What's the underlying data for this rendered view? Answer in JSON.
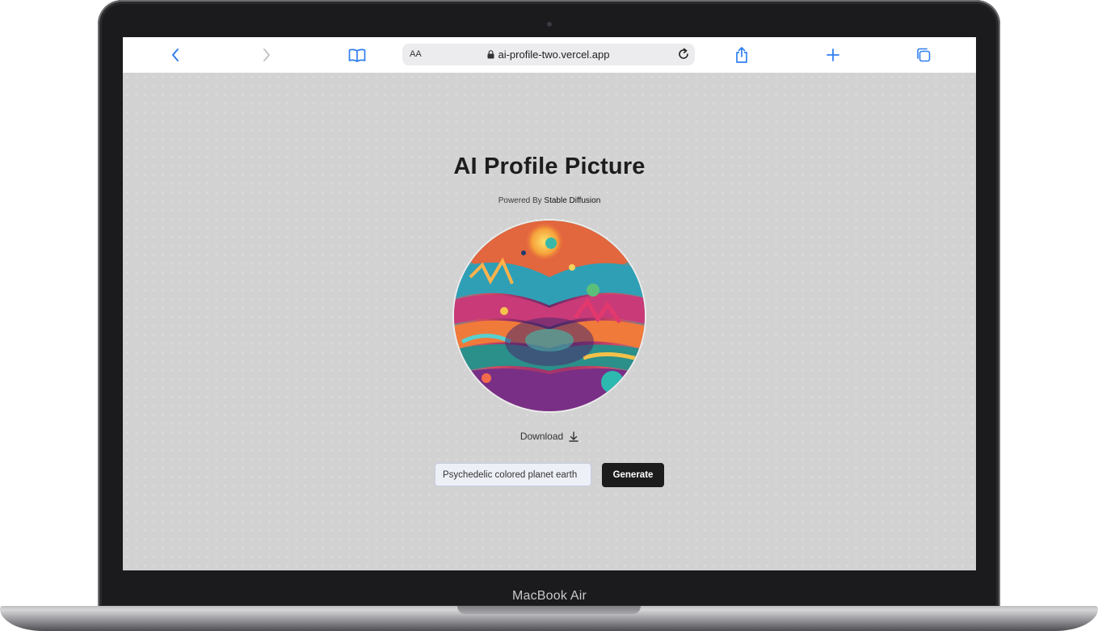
{
  "device": {
    "label": "MacBook Air"
  },
  "browser": {
    "address_prefix": "AA",
    "url": "ai-profile-two.vercel.app",
    "accent_color": "#2f7ff0",
    "icons": [
      "chevron-left-icon",
      "chevron-right-icon",
      "book-icon",
      "lock-icon",
      "reload-icon",
      "share-icon",
      "plus-icon",
      "tabs-icon"
    ]
  },
  "page": {
    "title": "AI Profile Picture",
    "subtitle_prefix": "Powered By",
    "subtitle_brand": "Stable Diffusion",
    "download_label": "Download",
    "prompt_value": "Psychedelic colored planet earth",
    "generate_label": "Generate",
    "background_color": "#d2d2d2",
    "button_color": "#1c1c1c"
  }
}
